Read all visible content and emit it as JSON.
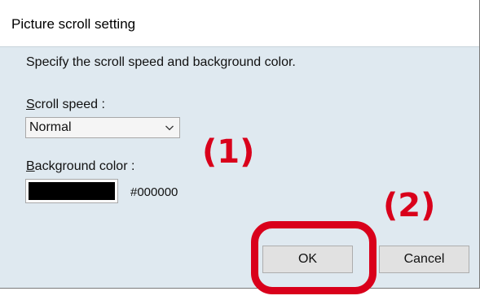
{
  "dialog": {
    "title": "Picture scroll setting",
    "instruction": "Specify the scroll speed and background color.",
    "scroll_speed": {
      "label_mnemonic": "S",
      "label_rest": "croll speed :",
      "selected_value": "Normal"
    },
    "background_color": {
      "label_mnemonic": "B",
      "label_rest": "ackground color :",
      "value_hex": "#000000",
      "swatch_color": "#000000"
    },
    "buttons": {
      "ok": "OK",
      "cancel": "Cancel"
    }
  },
  "annotations": {
    "marker_1": "(1)",
    "marker_2": "(2)",
    "color": "#d9001b"
  },
  "icons": {
    "select_chevron": "chevron-down-icon"
  }
}
